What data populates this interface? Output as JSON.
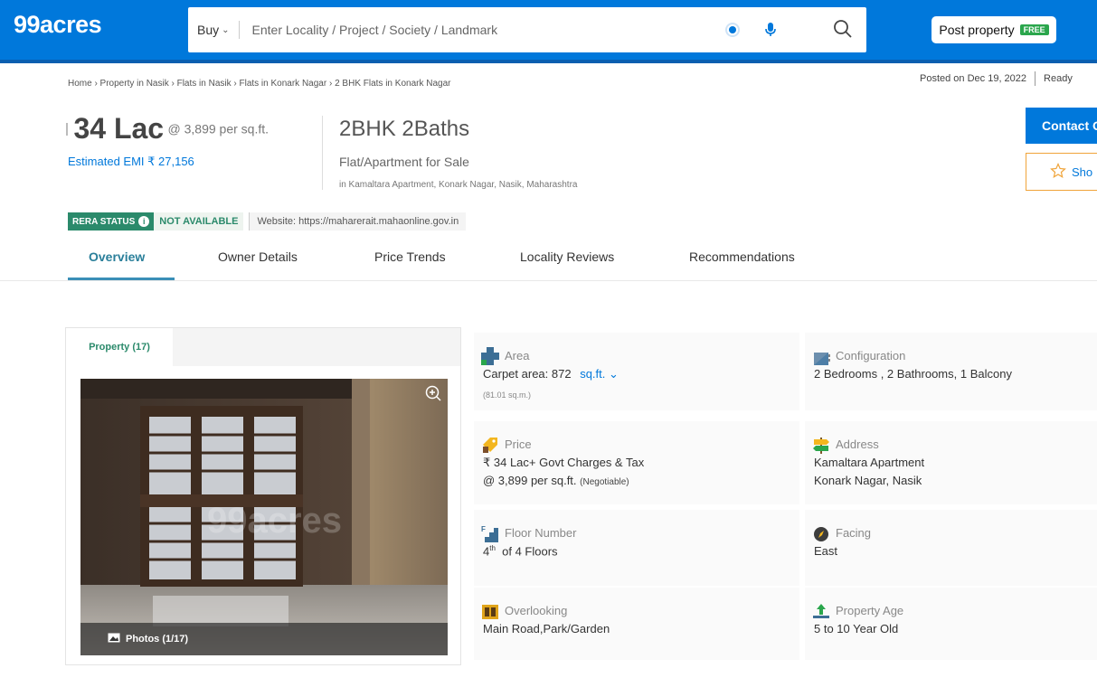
{
  "header": {
    "logo": "99acres",
    "buy_label": "Buy",
    "search_placeholder": "Enter Locality / Project / Society / Landmark",
    "post_property_label": "Post property",
    "free_badge": "FREE"
  },
  "breadcrumb": "Home › Property in Nasik › Flats in Nasik › Flats in Konark Nagar › 2 BHK Flats in Konark Nagar",
  "posted": {
    "date": "Posted on Dec 19, 2022",
    "status": "Ready"
  },
  "price": {
    "amount": "34 Lac",
    "per_sqft": "@ 3,899 per sq.ft.",
    "emi": "Estimated EMI ₹ 27,156"
  },
  "listing": {
    "title": "2BHK 2Baths",
    "type": "Flat/Apartment for Sale",
    "address": "in Kamaltara Apartment, Konark Nagar, Nasik, Maharashtra"
  },
  "cta": {
    "contact": "Contact O",
    "shortlist": "Sho"
  },
  "rera": {
    "label": "RERA STATUS",
    "status": "NOT AVAILABLE",
    "website": "Website: https://maharerait.mahaonline.gov.in"
  },
  "tabs": [
    "Overview",
    "Owner Details",
    "Price Trends",
    "Locality Reviews",
    "Recommendations"
  ],
  "gallery": {
    "tab_label": "Property (17)",
    "photos_label": "Photos (1/17)",
    "watermark": "99acres"
  },
  "details": {
    "area": {
      "label": "Area",
      "line1_prefix": "Carpet area: 872",
      "unit": "sq.ft.",
      "sub": "(81.01 sq.m.)"
    },
    "configuration": {
      "label": "Configuration",
      "value": "2 Bedrooms , 2 Bathrooms, 1 Balcony"
    },
    "price": {
      "label": "Price",
      "line1": "₹ 34 Lac+ Govt Charges & Tax",
      "line2": "@ 3,899 per sq.ft.",
      "negotiable": "(Negotiable)"
    },
    "address": {
      "label": "Address",
      "line1": "Kamaltara Apartment",
      "line2": "Konark Nagar, Nasik"
    },
    "floor": {
      "label": "Floor Number",
      "num": "4",
      "suffix": "th",
      "rest": "of 4 Floors"
    },
    "facing": {
      "label": "Facing",
      "value": "East"
    },
    "overlooking": {
      "label": "Overlooking",
      "value": "Main Road,Park/Garden"
    },
    "age": {
      "label": "Property Age",
      "value": "5 to 10 Year Old"
    }
  }
}
